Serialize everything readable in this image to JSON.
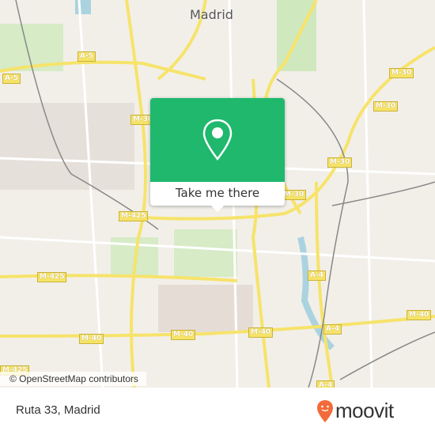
{
  "map": {
    "city_label": "Madrid",
    "road_labels": [
      "A-5",
      "A-5",
      "M-30",
      "M-30",
      "M-30",
      "M-30",
      "M-30",
      "M-425",
      "M-425",
      "A-4",
      "M-40",
      "A-4",
      "M-40",
      "M-40",
      "M-40",
      "M-425",
      "A-4"
    ],
    "attribution": "© OpenStreetMap contributors",
    "colors": {
      "background": "#f2efe9",
      "major_road": "#f6e36a",
      "park": "#cfe8bd",
      "water": "#aad3df"
    }
  },
  "popup": {
    "icon": "map-pin-icon",
    "button_label": "Take me there",
    "color": "#1fb86d"
  },
  "footer": {
    "place_name": "Ruta 33, Madrid",
    "brand": "moovit",
    "brand_color": "#f26b3a"
  }
}
